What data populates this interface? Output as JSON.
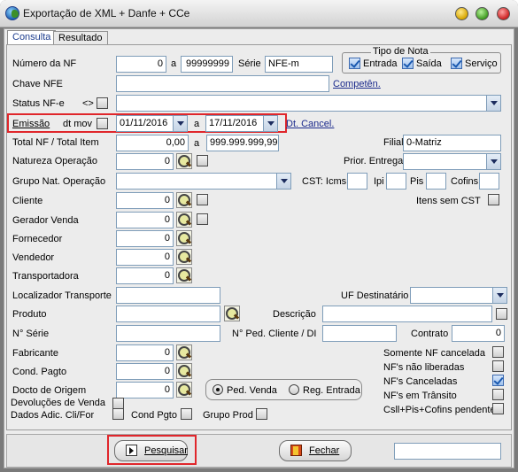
{
  "window": {
    "title": "Exportação de XML + Danfe + CCe"
  },
  "tabs": [
    {
      "label": "Consulta"
    },
    {
      "label": "Resultado"
    }
  ],
  "numero_nf": {
    "label": "Número da NF",
    "from": "0",
    "sep": "a",
    "to": "99999999",
    "serie_label": "Série",
    "serie": "NFE-m"
  },
  "tipo_nota": {
    "title": "Tipo de Nota",
    "entrada": "Entrada",
    "saida": "Saída",
    "servico": "Serviço"
  },
  "chave_nfe": {
    "label": "Chave NFE",
    "competen": "Competên."
  },
  "status_nfe": {
    "label": "Status NF-e",
    "neq": "<>"
  },
  "emissao": {
    "label": "Emissão",
    "dtmov": "dt mov",
    "from": "01/11/2016",
    "sep": "a",
    "to": "17/11/2016",
    "dt_cancel": "Dt. Cancel."
  },
  "total_nf": {
    "label": "Total NF / Total Item",
    "from": "0,00",
    "sep": "a",
    "to": "999.999.999,99",
    "filial_label": "Filial",
    "filial": "0-Matriz"
  },
  "natureza": {
    "label": "Natureza Operação",
    "value": "0",
    "prior_label": "Prior. Entrega"
  },
  "grupo_nat": {
    "label": "Grupo Nat. Operação",
    "cst_label": "CST: Icms",
    "ipi": "Ipi",
    "pis": "Pis",
    "cofins": "Cofins"
  },
  "cliente": {
    "label": "Cliente",
    "value": "0",
    "itens_sem_cst": "Itens sem CST"
  },
  "gerador_venda": {
    "label": "Gerador Venda",
    "value": "0"
  },
  "fornecedor": {
    "label": "Fornecedor",
    "value": "0"
  },
  "vendedor": {
    "label": "Vendedor",
    "value": "0"
  },
  "transportadora": {
    "label": "Transportadora",
    "value": "0"
  },
  "localizador": {
    "label": "Localizador Transporte",
    "uf_label": "UF Destinatário"
  },
  "produto": {
    "label": "Produto",
    "descricao": "Descrição"
  },
  "n_serie": {
    "label": "N° Série",
    "ped_cliente": "N° Ped. Cliente / DI",
    "contrato_label": "Contrato",
    "contrato": "0"
  },
  "fabricante": {
    "label": "Fabricante",
    "value": "0",
    "somente_cancelada": "Somente NF cancelada"
  },
  "cond_pagto": {
    "label": "Cond. Pagto",
    "value": "0",
    "nao_liberadas": "NF's não liberadas"
  },
  "docto_origem": {
    "label": "Docto de Origem",
    "value": "0",
    "canceladas": "NF's Canceladas",
    "em_transito": "NF's em Trânsito"
  },
  "radio": {
    "ped_venda": "Ped. Venda",
    "reg_entrada": "Reg. Entrada"
  },
  "devolucoes": {
    "label": "Devoluções de Venda"
  },
  "dados_adic": {
    "label": "Dados Adic. Cli/For",
    "cond_pgto": "Cond Pgto",
    "grupo_prod": "Grupo Prod",
    "csll": "Csll+Pis+Cofins pendente"
  },
  "buttons": {
    "pesquisar": "Pesquisar",
    "fechar": "Fechar"
  },
  "colors": {
    "highlight": "#e0262b",
    "link": "#1b2a8c"
  }
}
